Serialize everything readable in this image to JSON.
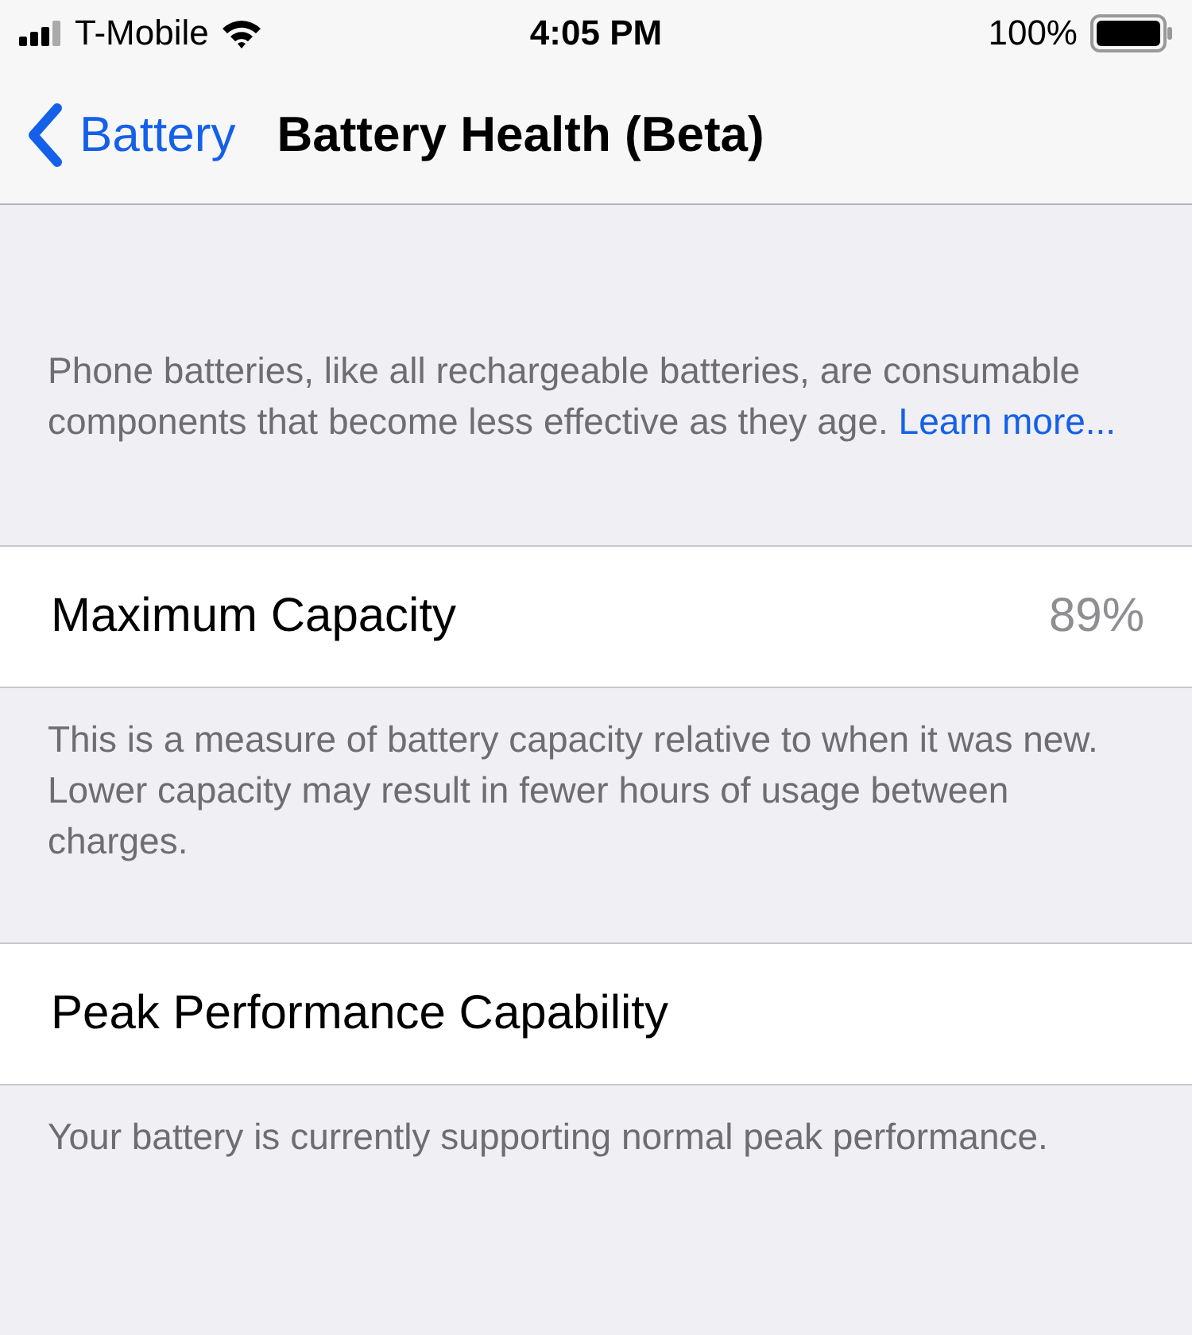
{
  "status_bar": {
    "carrier": "T-Mobile",
    "time": "4:05 PM",
    "battery": "100%"
  },
  "nav": {
    "back": "Battery",
    "title": "Battery Health (Beta)"
  },
  "intro": {
    "text": "Phone batteries, like all rechargeable batteries, are consumable components that become less effective as they age.",
    "link": "Learn more..."
  },
  "sections": [
    {
      "label": "Maximum Capacity",
      "value": "89%",
      "footer": "This is a measure of battery capacity relative to when it was new. Lower capacity may result in fewer hours of usage between charges."
    },
    {
      "label": "Peak Performance Capability",
      "footer": "Your battery is currently supporting normal peak performance."
    }
  ]
}
